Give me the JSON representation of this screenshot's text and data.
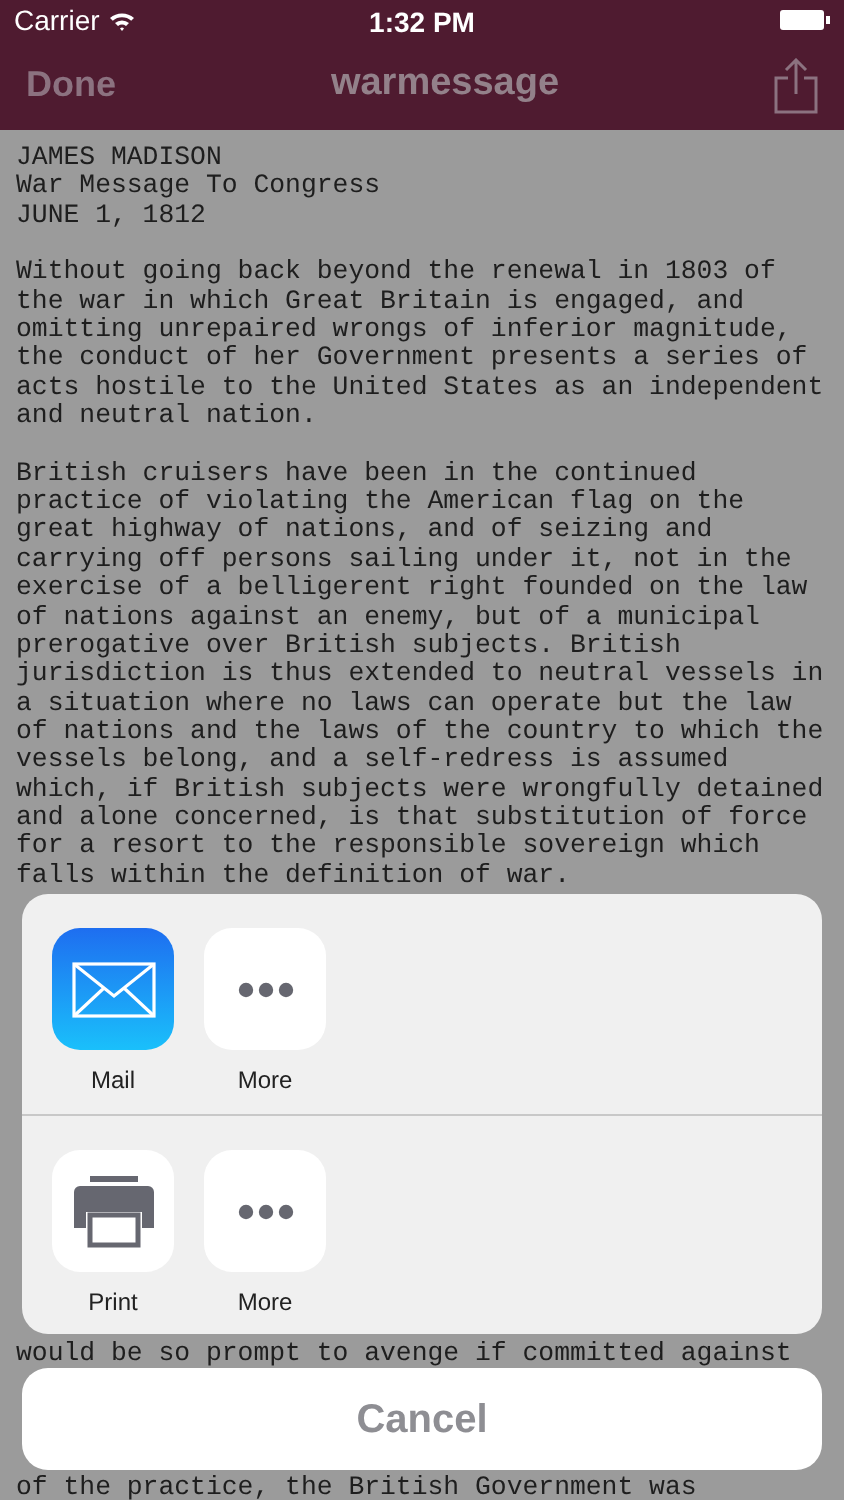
{
  "status_bar": {
    "carrier": "Carrier",
    "time": "1:32 PM"
  },
  "nav_bar": {
    "left_button": "Done",
    "title": "warmessage"
  },
  "document": {
    "blocks": [
      {
        "kind": "paragraph",
        "lines": [
          "JAMES MADISON",
          "War Message To Congress",
          "JUNE 1, 1812"
        ]
      },
      {
        "kind": "paragraph",
        "lines": [
          "Without going back beyond the renewal in 1803 of",
          "the war in which Great Britain is engaged, and",
          "omitting unrepaired wrongs of inferior magnitude,",
          "the conduct of her Government presents a series of",
          "acts hostile to the United States as an independent",
          "and neutral nation."
        ]
      },
      {
        "kind": "paragraph",
        "lines": [
          "British cruisers have been in the continued",
          "practice of violating the American flag on the",
          "great highway of nations, and of seizing and",
          "carrying off persons sailing under it, not in the",
          "exercise of a belligerent right founded on the law",
          "of nations against an enemy, but of a municipal",
          "prerogative over British subjects. British",
          "jurisdiction is thus extended to neutral vessels in",
          "a situation where no laws can operate but the law",
          "of nations and the laws of the country to which the",
          "vessels belong, and a self-redress is assumed",
          "which, if British subjects were wrongfully detained",
          "and alone concerned, is that substitution of force",
          "for a resort to the responsible sovereign which",
          "falls within the definition of war."
        ]
      },
      {
        "kind": "fragment",
        "lines": [
          "would be so prompt to avenge if committed against"
        ]
      },
      {
        "kind": "fragment",
        "lines": [
          "of the practice, the British Government was"
        ]
      }
    ]
  },
  "share_sheet": {
    "rows": [
      [
        {
          "label": "Mail",
          "kind": "mail"
        },
        {
          "label": "More",
          "kind": "more"
        }
      ],
      [
        {
          "label": "Print",
          "kind": "print"
        },
        {
          "label": "More",
          "kind": "more"
        }
      ]
    ],
    "cancel": "Cancel"
  }
}
